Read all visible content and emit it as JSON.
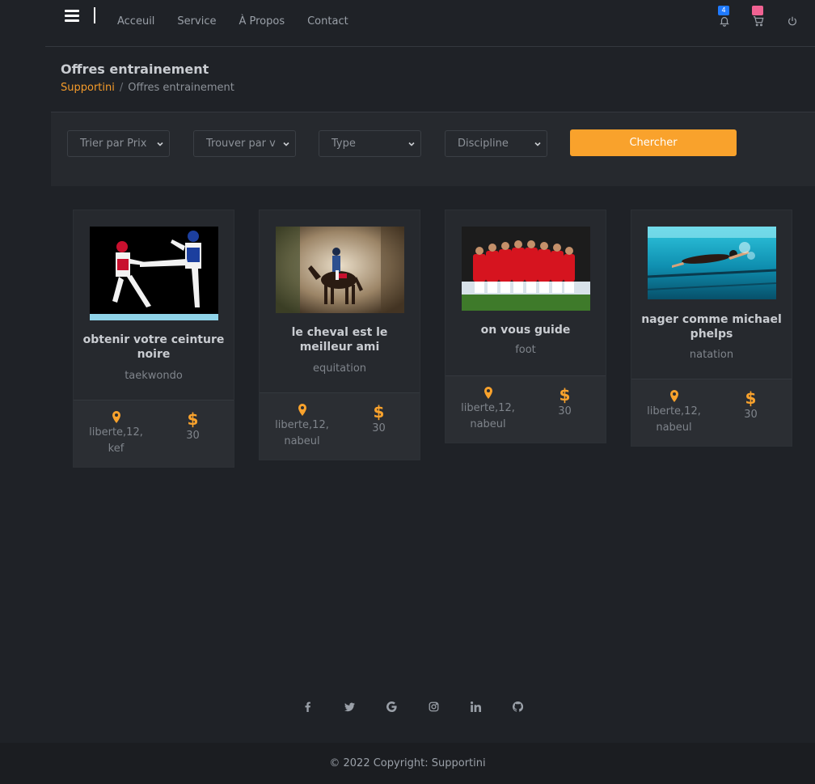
{
  "nav": {
    "links": [
      "Acceuil",
      "Service",
      "À Propos",
      "Contact"
    ],
    "notification_count": "4",
    "icons": [
      "hamburger-icon",
      "bell-icon",
      "cart-icon",
      "power-icon"
    ]
  },
  "page": {
    "title": "Offres entrainement",
    "breadcrumb_home": "Supportini",
    "breadcrumb_separator": "/",
    "breadcrumb_current": "Offres entrainement"
  },
  "filters": {
    "sort_price": "Trier par Prix",
    "find_by": "Trouver par v",
    "type": "Type",
    "discipline": "Discipline",
    "search_button": "Chercher"
  },
  "offers": [
    {
      "title": "obtenir votre ceinture noire",
      "discipline": "taekwondo",
      "location": "liberte,12, kef",
      "price": "30",
      "image": "taekwondo-kick-photo"
    },
    {
      "title": "le cheval est le meilleur ami",
      "discipline": "equitation",
      "location": "liberte,12, nabeul",
      "price": "30",
      "image": "horse-rider-photo"
    },
    {
      "title": "on vous guide",
      "discipline": "foot",
      "location": "liberte,12, nabeul",
      "price": "30",
      "image": "football-team-huddle-photo"
    },
    {
      "title": "nager comme michael phelps",
      "discipline": "natation",
      "location": "liberte,12, nabeul",
      "price": "30",
      "image": "swimmer-underwater-photo"
    }
  ],
  "social": [
    "facebook-icon",
    "twitter-icon",
    "google-icon",
    "instagram-icon",
    "linkedin-icon",
    "github-icon"
  ],
  "footer": {
    "copyright": "© 2022 Copyright: Supportini"
  },
  "colors": {
    "accent": "#f9a22c",
    "background": "#1f2227",
    "panel": "#26292e",
    "badge_blue": "#1f7aff",
    "badge_pink": "#f06292"
  }
}
